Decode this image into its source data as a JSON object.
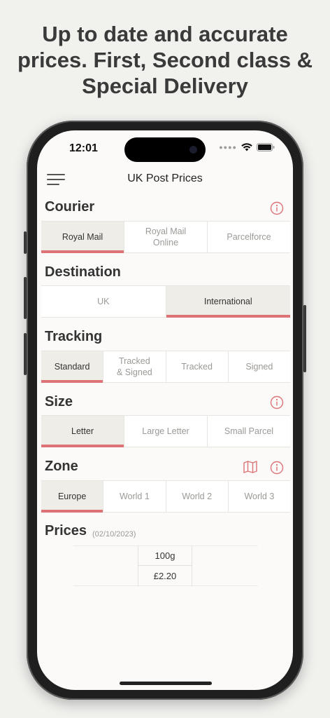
{
  "promo": {
    "line1": "Up to date and accurate",
    "line2": "prices. First, Second class &",
    "line3": "Special Delivery"
  },
  "status_bar": {
    "time": "12:01",
    "icons": [
      "signal-dots-icon",
      "wifi-icon",
      "battery-icon"
    ]
  },
  "nav": {
    "title": "UK Post Prices",
    "menu_icon": "hamburger-menu-icon"
  },
  "sections": {
    "courier": {
      "title": "Courier",
      "options": [
        "Royal Mail",
        "Royal Mail\nOnline",
        "Parcelforce"
      ],
      "selected": "Royal Mail"
    },
    "destination": {
      "title": "Destination",
      "options": [
        "UK",
        "International"
      ],
      "selected": "International"
    },
    "tracking": {
      "title": "Tracking",
      "options": [
        "Standard",
        "Tracked\n& Signed",
        "Tracked",
        "Signed"
      ],
      "selected": "Standard"
    },
    "size": {
      "title": "Size",
      "options": [
        "Letter",
        "Large Letter",
        "Small Parcel"
      ],
      "selected": "Letter"
    },
    "zone": {
      "title": "Zone",
      "options": [
        "Europe",
        "World 1",
        "World 2",
        "World 3"
      ],
      "selected": "Europe"
    }
  },
  "prices": {
    "title": "Prices",
    "date": "(02/10/2023)",
    "weight": "100g",
    "price": "£2.20"
  },
  "colors": {
    "accent": "#dd7377",
    "selected_bg": "#eeede7",
    "background": "#f1f1ee",
    "screen_bg": "#fbfaf8"
  }
}
